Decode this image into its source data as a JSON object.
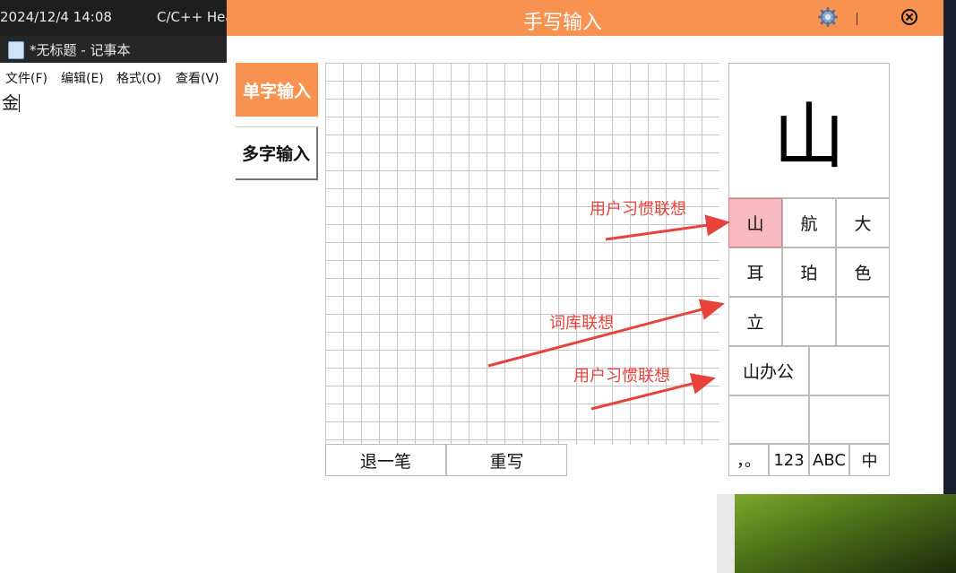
{
  "desktop": {
    "datetime": "2024/12/4 14:08",
    "tab_label": "C/C++ Hea"
  },
  "notepad": {
    "title": "*无标题 - 记事本",
    "menu": [
      "文件(F)",
      "编辑(E)",
      "格式(O)",
      "查看(V)"
    ],
    "content": "金"
  },
  "ime": {
    "title": "手写输入",
    "mode_single": "单字输入",
    "mode_multi": "多字输入",
    "undo_label": "退一笔",
    "rewrite_label": "重写",
    "preview_char": "山",
    "candidates": [
      [
        "山",
        "航",
        "大"
      ],
      [
        "耳",
        "珀",
        "色"
      ],
      [
        "立",
        "",
        ""
      ]
    ],
    "selected_candidate": "山",
    "phrases": [
      "山办公",
      "",
      "",
      ""
    ],
    "functions": [
      "，。",
      "123",
      "ABC",
      "中"
    ],
    "accent_color": "#f79250",
    "selected_color": "#f9b9c0"
  },
  "annotations": {
    "user_habit_1": "用户习惯联想",
    "lexicon": "词库联想",
    "user_habit_2": "用户习惯联想",
    "arrow_color": "#e8423c"
  }
}
